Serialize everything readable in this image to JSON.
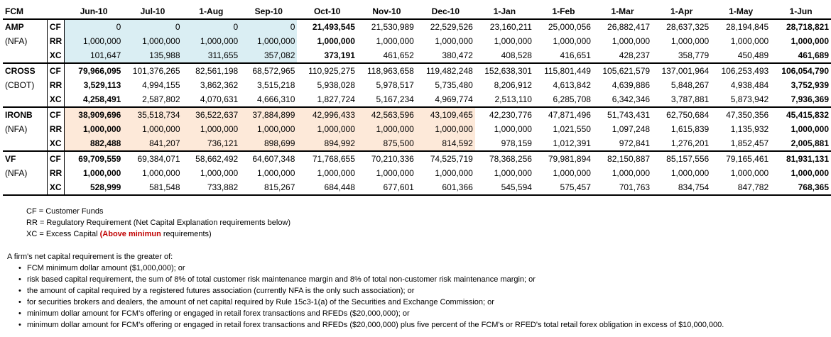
{
  "header": {
    "fcm": "FCM",
    "months": [
      "Jun-10",
      "Jul-10",
      "1-Aug",
      "Sep-10",
      "Oct-10",
      "Nov-10",
      "Dec-10",
      "1-Jan",
      "1-Feb",
      "1-Mar",
      "1-Apr",
      "1-May",
      "1-Jun"
    ]
  },
  "firms": [
    {
      "name": "AMP",
      "org": "(NFA)",
      "rows": [
        {
          "code": "CF",
          "values": [
            "0",
            "0",
            "0",
            "0",
            "21,493,545",
            "21,530,989",
            "22,529,526",
            "23,160,211",
            "25,000,056",
            "26,882,417",
            "28,637,325",
            "28,194,845",
            "28,718,821"
          ]
        },
        {
          "code": "RR",
          "values": [
            "1,000,000",
            "1,000,000",
            "1,000,000",
            "1,000,000",
            "1,000,000",
            "1,000,000",
            "1,000,000",
            "1,000,000",
            "1,000,000",
            "1,000,000",
            "1,000,000",
            "1,000,000",
            "1,000,000"
          ]
        },
        {
          "code": "XC",
          "values": [
            "101,647",
            "135,988",
            "311,655",
            "357,082",
            "373,191",
            "461,652",
            "380,472",
            "408,528",
            "416,651",
            "428,237",
            "358,779",
            "450,489",
            "461,689"
          ]
        }
      ]
    },
    {
      "name": "CROSS",
      "org": "(CBOT)",
      "rows": [
        {
          "code": "CF",
          "values": [
            "79,966,095",
            "101,376,265",
            "82,561,198",
            "68,572,965",
            "110,925,275",
            "118,963,658",
            "119,482,248",
            "152,638,301",
            "115,801,449",
            "105,621,579",
            "137,001,964",
            "106,253,493",
            "106,054,790"
          ]
        },
        {
          "code": "RR",
          "values": [
            "3,529,113",
            "4,994,155",
            "3,862,362",
            "3,515,218",
            "5,938,028",
            "5,978,517",
            "5,735,480",
            "8,206,912",
            "4,613,842",
            "4,639,886",
            "5,848,267",
            "4,938,484",
            "3,752,939"
          ]
        },
        {
          "code": "XC",
          "values": [
            "4,258,491",
            "2,587,802",
            "4,070,631",
            "4,666,310",
            "1,827,724",
            "5,167,234",
            "4,969,774",
            "2,513,110",
            "6,285,708",
            "6,342,346",
            "3,787,881",
            "5,873,942",
            "7,936,369"
          ]
        }
      ]
    },
    {
      "name": "IRONB",
      "org": "(NFA)",
      "rows": [
        {
          "code": "CF",
          "values": [
            "38,909,696",
            "35,518,734",
            "36,522,637",
            "37,884,899",
            "42,996,433",
            "42,563,596",
            "43,109,465",
            "42,230,776",
            "47,871,496",
            "51,743,431",
            "62,750,684",
            "47,350,356",
            "45,415,832"
          ]
        },
        {
          "code": "RR",
          "values": [
            "1,000,000",
            "1,000,000",
            "1,000,000",
            "1,000,000",
            "1,000,000",
            "1,000,000",
            "1,000,000",
            "1,000,000",
            "1,021,550",
            "1,097,248",
            "1,615,839",
            "1,135,932",
            "1,000,000"
          ]
        },
        {
          "code": "XC",
          "values": [
            "882,488",
            "841,207",
            "736,121",
            "898,699",
            "894,992",
            "875,500",
            "814,592",
            "978,159",
            "1,012,391",
            "972,841",
            "1,276,201",
            "1,852,457",
            "2,005,881"
          ]
        }
      ]
    },
    {
      "name": "VF",
      "org": "(NFA)",
      "rows": [
        {
          "code": "CF",
          "values": [
            "69,709,559",
            "69,384,071",
            "58,662,492",
            "64,607,348",
            "71,768,655",
            "70,210,336",
            "74,525,719",
            "78,368,256",
            "79,981,894",
            "82,150,887",
            "85,157,556",
            "79,165,461",
            "81,931,131"
          ]
        },
        {
          "code": "RR",
          "values": [
            "1,000,000",
            "1,000,000",
            "1,000,000",
            "1,000,000",
            "1,000,000",
            "1,000,000",
            "1,000,000",
            "1,000,000",
            "1,000,000",
            "1,000,000",
            "1,000,000",
            "1,000,000",
            "1,000,000"
          ]
        },
        {
          "code": "XC",
          "values": [
            "528,999",
            "581,548",
            "733,882",
            "815,267",
            "684,448",
            "677,601",
            "601,366",
            "545,594",
            "575,457",
            "701,763",
            "834,754",
            "847,782",
            "768,365"
          ]
        }
      ]
    }
  ],
  "legend": {
    "cf": "CF = Customer Funds",
    "rr": "RR = Regulatory Requirement (Net Capital Explanation requirements below)",
    "xc_prefix": "XC = Excess Capital ",
    "xc_highlight": "(Above minimun",
    "xc_suffix": " requirements)"
  },
  "notes": {
    "intro": "A firm's net capital requirement is the greater of:",
    "items": [
      "FCM minimum dollar amount ($1,000,000); or",
      "risk based capital requirement, the sum of 8% of total customer risk maintenance margin and 8% of total non-customer risk maintenance margin; or",
      "the amount of capital required by a registered futures association (currently NFA is the only such association); or",
      "for securities brokers and dealers, the amount of net capital required by Rule 15c3-1(a) of the Securities and Exchange Commission; or",
      "minimum dollar amount for FCM's offering or engaged in retail forex transactions and RFEDs ($20,000,000); or",
      "minimum dollar amount for FCM's offering or engaged in retail forex transactions and RFEDs ($20,000,000) plus five percent of the FCM's or RFED's total retail forex obligation in excess of $10,000,000."
    ]
  },
  "colors": {
    "highlight_blue": "#daeef3",
    "highlight_peach": "#fde9d9",
    "legend_red": "#c00000"
  }
}
